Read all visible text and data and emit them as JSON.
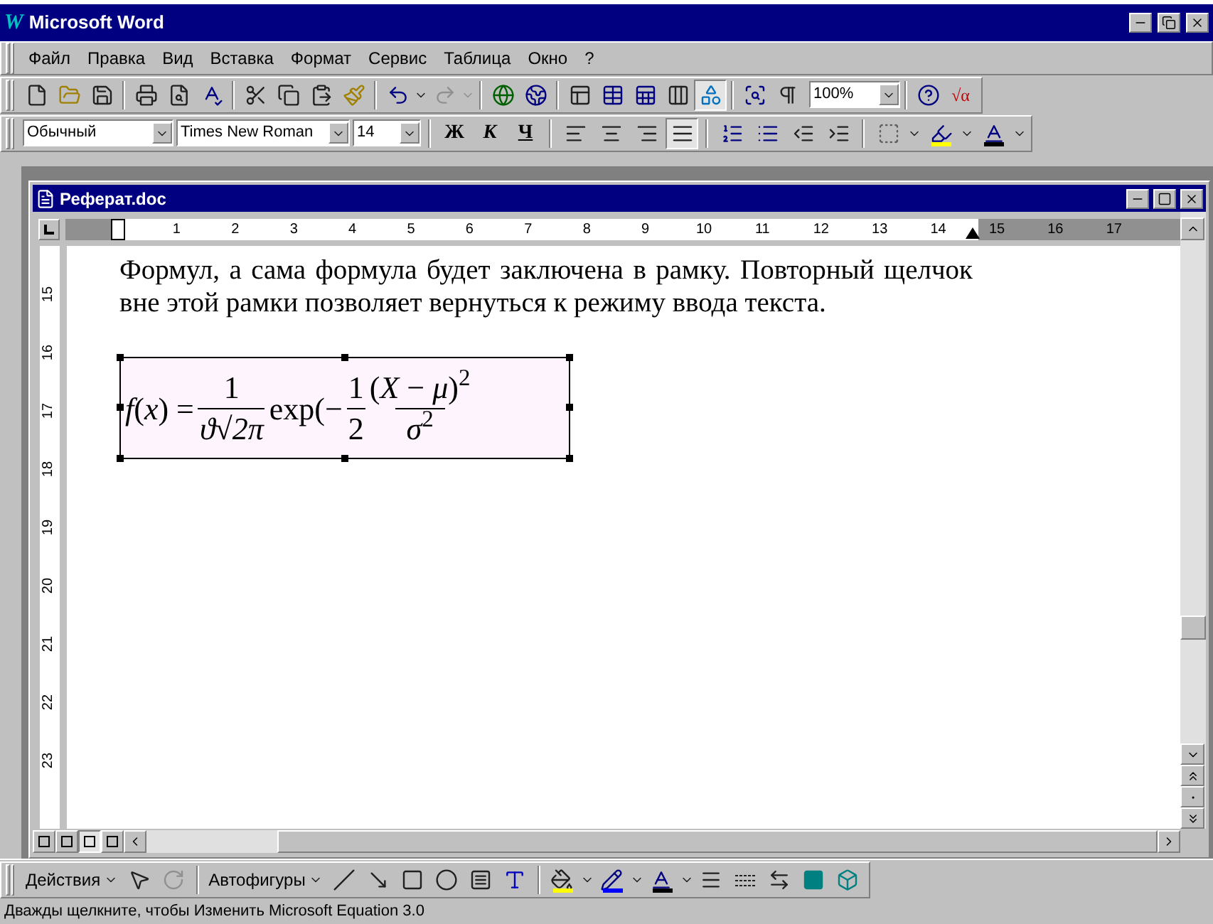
{
  "window": {
    "logo": "W",
    "title": "Microsoft Word"
  },
  "menu": [
    "Файл",
    "Правка",
    "Вид",
    "Вставка",
    "Формат",
    "Сервис",
    "Таблица",
    "Окно",
    "?"
  ],
  "standard_toolbar": {
    "drawing_button": {
      "pressed": true
    },
    "zoom": "100%",
    "equation_button": "√α"
  },
  "formatting_toolbar": {
    "style": "Обычный",
    "font": "Times New Roman",
    "size": "14",
    "bold": "Ж",
    "italic": "К",
    "underline": "Ч",
    "alignment": [
      {
        "selected": false
      },
      {
        "selected": false
      },
      {
        "selected": false
      },
      {
        "selected": true
      }
    ]
  },
  "document": {
    "title": "Реферат.doc",
    "ruler_marks": [
      "1",
      "2",
      "3",
      "4",
      "5",
      "6",
      "7",
      "8",
      "9",
      "10",
      "11",
      "12",
      "13",
      "14",
      "15",
      "16",
      "17"
    ],
    "vertical_ruler_marks": [
      "15",
      "16",
      "17",
      "18",
      "19",
      "20",
      "21",
      "22",
      "23"
    ],
    "paragraph": "Формул, а сама формула будет заключена в рамку. Повторный щелчок вне этой рамки позволяет вернуться к режиму ввода текста.",
    "equation": {
      "lhs": "*f*(*x*) =",
      "coef": {
        "num": "1",
        "den": "ϑ√2π"
      },
      "func": "exp(−",
      "half": {
        "num": "1",
        "den": "2"
      },
      "ratio": {
        "num": "(*X* − *μ*)$^{2}$",
        "den": "*σ*$^{2}$"
      }
    },
    "view_buttons": [
      {
        "selected": false
      },
      {
        "selected": false
      },
      {
        "selected": true
      },
      {
        "selected": false
      }
    ]
  },
  "drawing_toolbar": {
    "actions": "Действия",
    "autoshapes": "Автофигуры"
  },
  "status_bar": "Дважды щелкните, чтобы Изменить Microsoft Equation 3.0"
}
